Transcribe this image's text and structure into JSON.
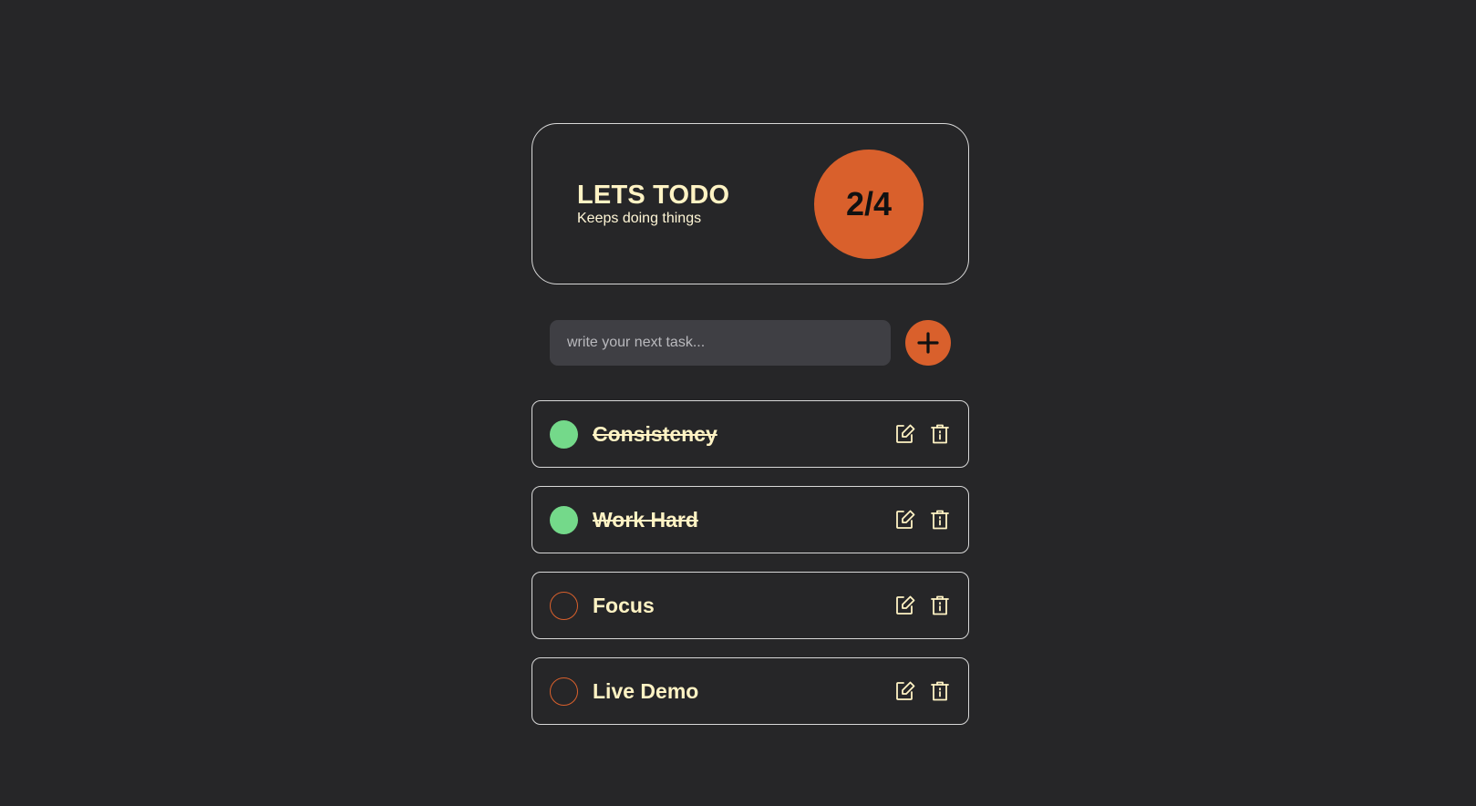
{
  "header": {
    "title": "LETS TODO",
    "subtitle": "Keeps doing things",
    "progress_label": "2/4",
    "completed": 2,
    "total": 4
  },
  "form": {
    "placeholder": "write your next task...",
    "value": "",
    "add_icon": "plus-icon"
  },
  "todos": [
    {
      "label": "Consistency",
      "done": true
    },
    {
      "label": "Work Hard",
      "done": true
    },
    {
      "label": "Focus",
      "done": false
    },
    {
      "label": "Live Demo",
      "done": false
    }
  ],
  "icons": {
    "edit": "edit-icon",
    "delete": "trash-icon"
  },
  "colors": {
    "background": "#262628",
    "accent": "#d9602c",
    "done": "#74d98a",
    "text": "#fff3c4",
    "input_bg": "#3f3f44",
    "border": "#d8d8d8"
  }
}
